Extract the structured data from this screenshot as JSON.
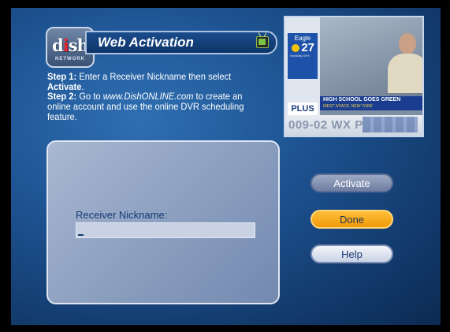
{
  "logo": {
    "brand_main": "d",
    "brand_dot": "i",
    "brand_tail": "sh",
    "brand_sub": "NETWORK"
  },
  "header": {
    "title": "Web Activation"
  },
  "instructions": {
    "step1_label": "Step 1:",
    "step1_text_a": " Enter a Receiver Nickname then select ",
    "step1_emph": "Activate",
    "step1_text_b": ".",
    "step2_label": "Step 2:",
    "step2_text_a": " Go to ",
    "step2_url": "www.DishONLINE.com",
    "step2_text_b": " to create an online account and use the online DVR scheduling feature."
  },
  "preview": {
    "place": "Eagle",
    "temperature": "27",
    "humidity": "Humidity 60%",
    "banner_title": "HIGH SCHOOL GOES GREEN",
    "banner_sub": "WEST NYACK, NEW YORK",
    "plus_label": "PLUS",
    "channel_code": "009-02 WX P"
  },
  "form": {
    "nickname_label": "Receiver Nickname:",
    "nickname_value": ""
  },
  "buttons": {
    "activate": "Activate",
    "done": "Done",
    "help": "Help"
  },
  "colors": {
    "done_highlight": "#f5a818",
    "panel_border": "#dfe7f3",
    "title_bar": "#0e3468"
  }
}
